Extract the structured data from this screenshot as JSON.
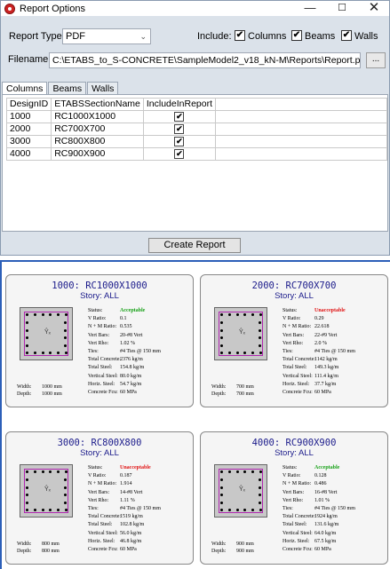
{
  "window": {
    "title": "Report Options",
    "min": "—",
    "max": "☐",
    "close": "✕"
  },
  "options": {
    "report_type_label": "Report Type:",
    "report_type_value": "PDF",
    "include_label": "Include:",
    "include": [
      {
        "label": "Columns",
        "checked": true
      },
      {
        "label": "Beams",
        "checked": true
      },
      {
        "label": "Walls",
        "checked": true
      }
    ],
    "filename_label": "Filename:",
    "filename_value": "C:\\ETABS_to_S-CONCRETE\\SampleModel2_v18_kN-M\\Reports\\Report.pdf",
    "browse_label": "..."
  },
  "tabs": [
    "Columns",
    "Beams",
    "Walls"
  ],
  "grid": {
    "headers": [
      "DesignID",
      "ETABSSectionName",
      "IncludeInReport"
    ],
    "rows": [
      [
        "1000",
        "RC1000X1000",
        "✔"
      ],
      [
        "2000",
        "RC700X700",
        "✔"
      ],
      [
        "3000",
        "RC800X800",
        "✔"
      ],
      [
        "4000",
        "RC900X900",
        "✔"
      ]
    ]
  },
  "create_button": "Create Report",
  "check_mark": "✔",
  "axis_mark": "Ŷₓ",
  "cards": [
    {
      "title": "1000: RC1000X1000",
      "story": "Story: ALL",
      "width_label": "Width:",
      "width": "1000 mm",
      "depth_label": "Depth:",
      "depth": "1000 mm",
      "status_label": "Status:",
      "status": "Acceptable",
      "status_ok": true,
      "props": [
        [
          "V Ratio:",
          "0.1"
        ],
        [
          "N + M Ratio:",
          "0.535"
        ],
        [
          "Vert Bars:",
          "20-#8 Vert"
        ],
        [
          "Vert Rho:",
          "1.02 %"
        ],
        [
          "Ties:",
          "#4 Ties @ 150 mm"
        ],
        [
          "Total Concrete:",
          "2376 kg/m"
        ],
        [
          "Total Steel:",
          "154.8 kg/m"
        ],
        [
          "Vertical Steel:",
          "80.0 kg/m"
        ],
        [
          "Horiz. Steel:",
          "54.7 kg/m"
        ],
        [
          "Concrete Fcu:",
          "60 MPa"
        ]
      ]
    },
    {
      "title": "2000: RC700X700",
      "story": "Story: ALL",
      "width_label": "Width:",
      "width": "700 mm",
      "depth_label": "Depth:",
      "depth": "700 mm",
      "status_label": "Status:",
      "status": "Unacceptable",
      "status_ok": false,
      "props": [
        [
          "V Ratio:",
          "0.29"
        ],
        [
          "N + M Ratio:",
          "22.618"
        ],
        [
          "Vert Bars:",
          "22-#9 Vert"
        ],
        [
          "Vert Rho:",
          "2.0 %"
        ],
        [
          "Ties:",
          "#4 Ties @ 150 mm"
        ],
        [
          "Total Concrete:",
          "1142 kg/m"
        ],
        [
          "Total Steel:",
          "149.3 kg/m"
        ],
        [
          "Vertical Steel:",
          "111.4 kg/m"
        ],
        [
          "Horiz. Steel:",
          "37.7 kg/m"
        ],
        [
          "Concrete Fcu:",
          "60 MPa"
        ]
      ]
    },
    {
      "title": "3000: RC800X800",
      "story": "Story: ALL",
      "width_label": "Width:",
      "width": "800 mm",
      "depth_label": "Depth:",
      "depth": "800 mm",
      "status_label": "Status:",
      "status": "Unacceptable",
      "status_ok": false,
      "props": [
        [
          "V Ratio:",
          "0.187"
        ],
        [
          "N + M Ratio:",
          "1.914"
        ],
        [
          "Vert Bars:",
          "14-#8 Vert"
        ],
        [
          "Vert Rho:",
          "1.11 %"
        ],
        [
          "Ties:",
          "#4 Ties @ 150 mm"
        ],
        [
          "Total Concrete:",
          "1519 kg/m"
        ],
        [
          "Total Steel:",
          "102.8 kg/m"
        ],
        [
          "Vertical Steel:",
          "56.0 kg/m"
        ],
        [
          "Horiz. Steel:",
          "46.8 kg/m"
        ],
        [
          "Concrete Fcu:",
          "60 MPa"
        ]
      ]
    },
    {
      "title": "4000: RC900X900",
      "story": "Story: ALL",
      "width_label": "Width:",
      "width": "900 mm",
      "depth_label": "Depth:",
      "depth": "900 mm",
      "status_label": "Status:",
      "status": "Acceptable",
      "status_ok": true,
      "props": [
        [
          "V Ratio:",
          "0.128"
        ],
        [
          "N + M Ratio:",
          "0.486"
        ],
        [
          "Vert Bars:",
          "16-#8 Vert"
        ],
        [
          "Vert Rho:",
          "1.01 %"
        ],
        [
          "Ties:",
          "#4 Ties @ 150 mm"
        ],
        [
          "Total Concrete:",
          "1924 kg/m"
        ],
        [
          "Total Steel:",
          "131.6 kg/m"
        ],
        [
          "Vertical Steel:",
          "64.0 kg/m"
        ],
        [
          "Horiz. Steel:",
          "67.5 kg/m"
        ],
        [
          "Concrete Fcu:",
          "60 MPa"
        ]
      ]
    }
  ]
}
